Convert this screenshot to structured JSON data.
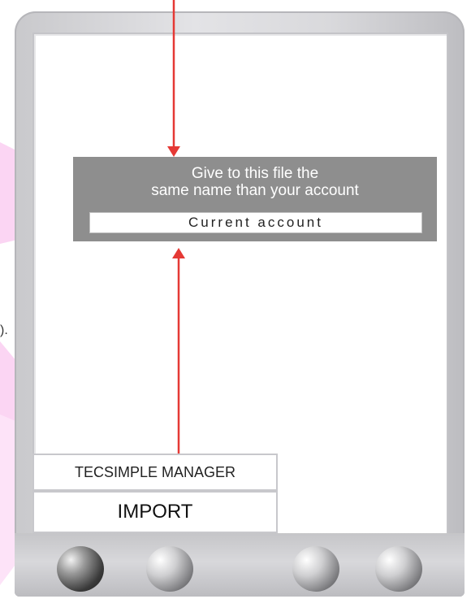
{
  "dialog": {
    "line1": "Give to this file the",
    "line2": "same name than your account",
    "account_field": "Current account"
  },
  "side_text": ").",
  "manager": {
    "label": "TECSIMPLE MANAGER",
    "import_label": "IMPORT"
  },
  "colors": {
    "arrow": "#e53935",
    "dialog_bg": "#8e8e8e",
    "background_accent": "#f8c8ef"
  },
  "icons": {
    "arrow_down": "arrow-down-icon",
    "arrow_up": "arrow-up-icon"
  }
}
